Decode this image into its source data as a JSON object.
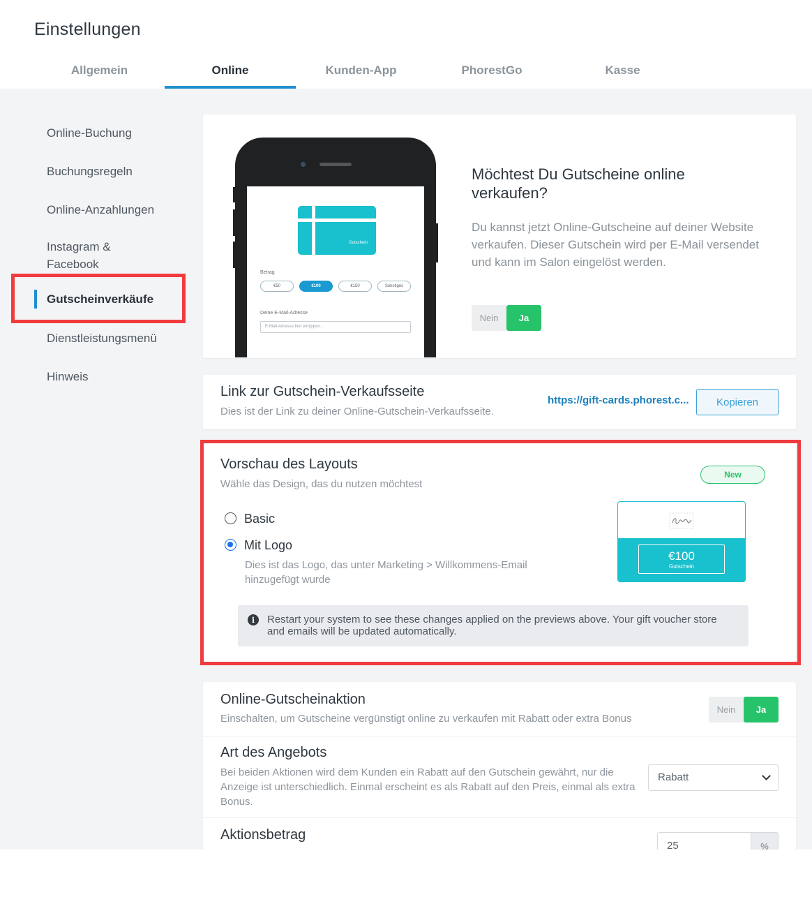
{
  "header": {
    "title": "Einstellungen",
    "tabs": [
      {
        "label": "Allgemein"
      },
      {
        "label": "Online"
      },
      {
        "label": "Kunden-App"
      },
      {
        "label": "PhorestGo"
      },
      {
        "label": "Kasse"
      }
    ],
    "active_tab": "Online"
  },
  "sidebar": {
    "items": [
      {
        "label": "Online-Buchung"
      },
      {
        "label": "Buchungsregeln"
      },
      {
        "label": "Online-Anzahlungen"
      },
      {
        "label": "Instagram & Facebook"
      },
      {
        "label": "Gutscheinverkäufe"
      },
      {
        "label": "Dienstleistungsmenü"
      },
      {
        "label": "Hinweis"
      }
    ],
    "active_item": "Gutscheinverkäufe"
  },
  "promo": {
    "title": "Möchtest Du Gutscheine online verkaufen?",
    "text": "Du kannst jetzt Online-Gutscheine auf deiner Website verkaufen. Dieser Gutschein wird per E-Mail versendet und kann im Salon eingelöst werden.",
    "toggle": {
      "no": "Nein",
      "yes": "Ja",
      "value": "Ja"
    },
    "phone": {
      "card_label": "Gutschein",
      "amount_label": "Betrag",
      "amounts": [
        "€50",
        "€100",
        "€150",
        "Sonstiges"
      ],
      "selected_amount": "€100",
      "email_label": "Deine E-Mail-Adresse",
      "email_placeholder": "E-Mail-Adresse hier eintippen..."
    }
  },
  "link_section": {
    "title": "Link zur Gutschein-Verkaufsseite",
    "subtitle": "Dies ist der Link zu deiner Online-Gutschein-Verkaufsseite.",
    "url": "https://gift-cards.phorest.c...",
    "copy_label": "Kopieren"
  },
  "layout_section": {
    "title": "Vorschau des Layouts",
    "subtitle": "Wähle das Design, das du nutzen möchtest",
    "badge": "New",
    "options": [
      {
        "label": "Basic",
        "selected": false
      },
      {
        "label": "Mit Logo",
        "selected": true
      }
    ],
    "option_description": "Dies ist das Logo, das unter Marketing > Willkommens-Email hinzugefügt wurde",
    "preview": {
      "amount": "€100",
      "label": "Gutschein"
    },
    "info": "Restart your system to see these changes applied on the previews above. Your gift voucher store and emails will be updated automatically."
  },
  "promotion_section": {
    "title": "Online-Gutscheinaktion",
    "subtitle": "Einschalten, um Gutscheine vergünstigt online zu verkaufen mit Rabatt oder extra Bonus",
    "toggle": {
      "no": "Nein",
      "yes": "Ja",
      "value": "Ja"
    },
    "offer_type": {
      "title": "Art des Angebots",
      "description": "Bei beiden Aktionen wird dem Kunden ein Rabatt auf den Gutschein gewährt, nur die Anzeige ist unterschiedlich. Einmal erscheint es als Rabatt auf den Preis, einmal als extra Bonus.",
      "selected": "Rabatt"
    },
    "amount": {
      "title": "Aktionsbetrag",
      "value": "25",
      "unit": "%"
    }
  },
  "colors": {
    "accent": "#1f8fce",
    "success": "#27c36a",
    "highlight": "#f03c3e",
    "card_teal": "#19c0ce"
  }
}
